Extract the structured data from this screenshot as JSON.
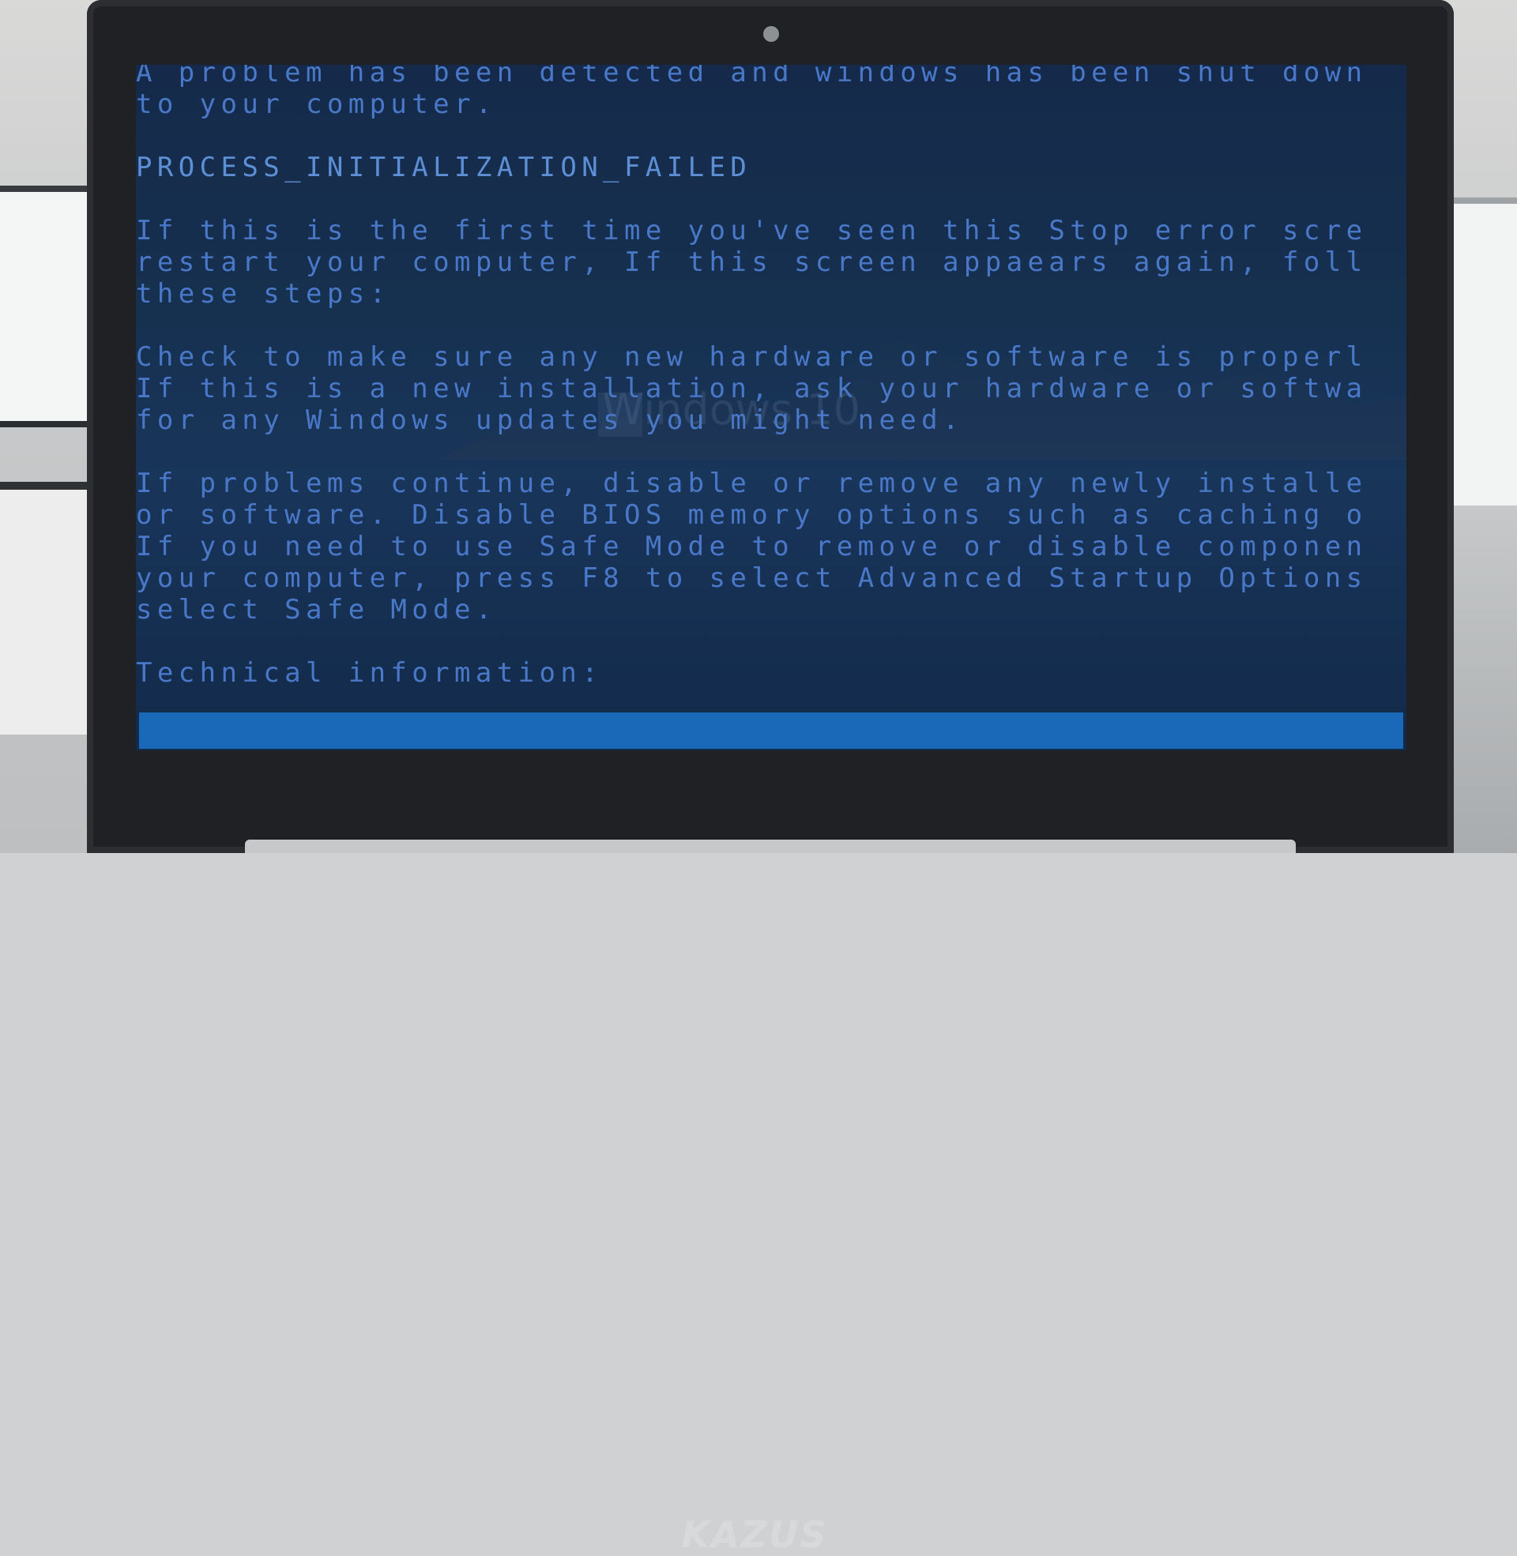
{
  "device": {
    "brand_logo": "KAZUS"
  },
  "screen": {
    "watermark": "Windows 10",
    "lines": [
      "A problem has been detected and windows has been shut down",
      "to your computer.",
      "",
      "PROCESS_INITIALIZATION_FAILED",
      "",
      "If this is the first time you've seen this Stop error scre",
      "restart your computer, If this screen appaears again, foll",
      "these steps:",
      "",
      "Check to make sure any new hardware or software is properl",
      "If this is a new installation, ask your hardware or softwa",
      "for any Windows updates you might need.",
      "",
      "If problems continue, disable or remove any newly installe",
      "or software. Disable BIOS memory options such as caching o",
      "If you need to use Safe Mode to remove or disable componen",
      "your computer, press F8 to select Advanced Startup Options",
      "select Safe Mode.",
      "",
      "Technical information:"
    ]
  },
  "colors": {
    "screen_bg": "#16304f",
    "text": "#4a78c8",
    "progress_bar": "#1a69b8"
  }
}
